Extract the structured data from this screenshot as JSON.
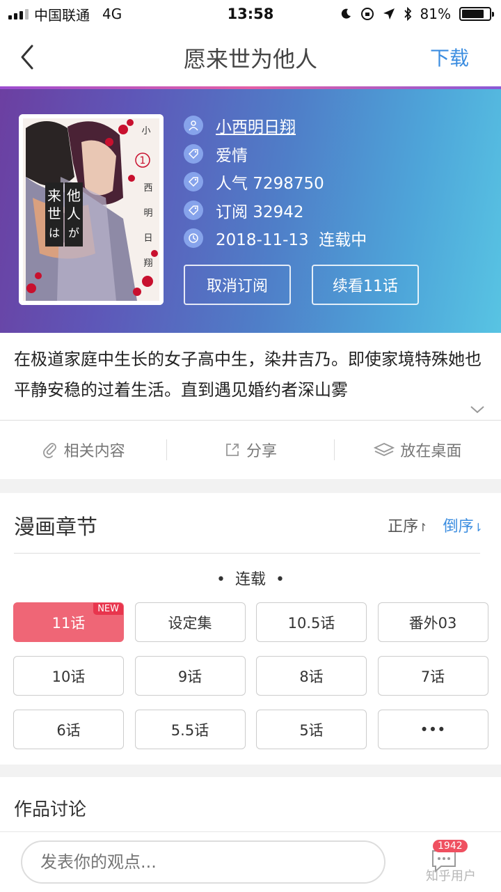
{
  "status_bar": {
    "carrier": "中国联通",
    "network": "4G",
    "time": "13:58",
    "battery": "81%",
    "battery_level": 0.81
  },
  "nav": {
    "title": "愿来世为他人",
    "action": "下载",
    "back_icon": "chevron-left-icon"
  },
  "info": {
    "author": "小西明日翔",
    "genre": "爱情",
    "popularity": "人气 7298750",
    "subscriptions": "订阅 32942",
    "update": "2018-11-13  连载中",
    "unsubscribe_label": "取消订阅",
    "continue_label": "续看11话",
    "accent_color": "#3b8de0"
  },
  "cover": {
    "title_vertical": "小西明日翔",
    "volume": "1"
  },
  "description": "在极道家庭中生长的女子高中生，染井吉乃。即使家境特殊她也平静安稳的过着生活。直到遇见婚约者深山雾",
  "actions": {
    "related": "相关内容",
    "share": "分享",
    "desktop": "放在桌面"
  },
  "chapters": {
    "title": "漫画章节",
    "sort_asc": "正序",
    "sort_desc": "倒序",
    "section": "•  连载  •",
    "new_badge": "NEW",
    "items": [
      "11话",
      "设定集",
      "10.5话",
      "番外03",
      "10话",
      "9话",
      "8话",
      "7话",
      "6话",
      "5.5话",
      "5话",
      "•••"
    ],
    "active_color": "#ef6676"
  },
  "discussion": {
    "title": "作品讨论",
    "placeholder": "发表你的观点...",
    "count": "1942",
    "watermark": "知乎用户"
  }
}
